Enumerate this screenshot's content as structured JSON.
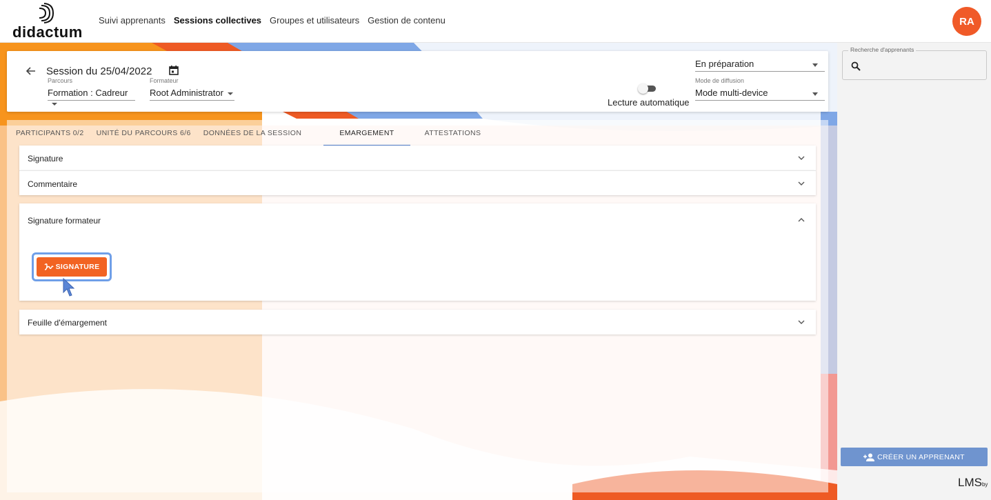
{
  "brand": {
    "name": "didactum"
  },
  "nav": [
    {
      "label": "Suivi apprenants",
      "active": false
    },
    {
      "label": "Sessions collectives",
      "active": true
    },
    {
      "label": "Groupes et utilisateurs",
      "active": false
    },
    {
      "label": "Gestion de contenu",
      "active": false
    }
  ],
  "user": {
    "initials": "RA",
    "color": "#f05a28"
  },
  "session": {
    "title": "Session du 25/04/2022",
    "parcours_label": "Parcours",
    "parcours_value": "Formation : Cadreur",
    "formateur_label": "Formateur",
    "formateur_value": "Root Administrator",
    "status_value": "En préparation",
    "autoplay_label": "Lecture automatique",
    "autoplay_on": false,
    "diffusion_label": "Mode de diffusion",
    "diffusion_value": "Mode multi-device"
  },
  "tabs": [
    {
      "label": "PARTICIPANTS 0/2",
      "active": false
    },
    {
      "label": "UNITÉ DU PARCOURS 6/6",
      "active": false
    },
    {
      "label": "DONNÉES DE LA SESSION",
      "active": false
    },
    {
      "label": "EMARGEMENT",
      "active": true
    },
    {
      "label": "ATTESTATIONS",
      "active": false
    }
  ],
  "sections": {
    "signature": "Signature",
    "commentaire": "Commentaire",
    "signature_formateur": "Signature formateur",
    "signature_button": "SIGNATURE",
    "feuille": "Feuille d'émargement"
  },
  "sidebar": {
    "search_legend": "Recherche d'apprenants",
    "search_value": "",
    "create_button": "CRÉER UN APPRENANT",
    "footer_logo": "LMS",
    "footer_by": "by"
  },
  "colors": {
    "accent": "#f26322",
    "primary": "#6f94cf",
    "tab_underline": "#4a78c8"
  }
}
